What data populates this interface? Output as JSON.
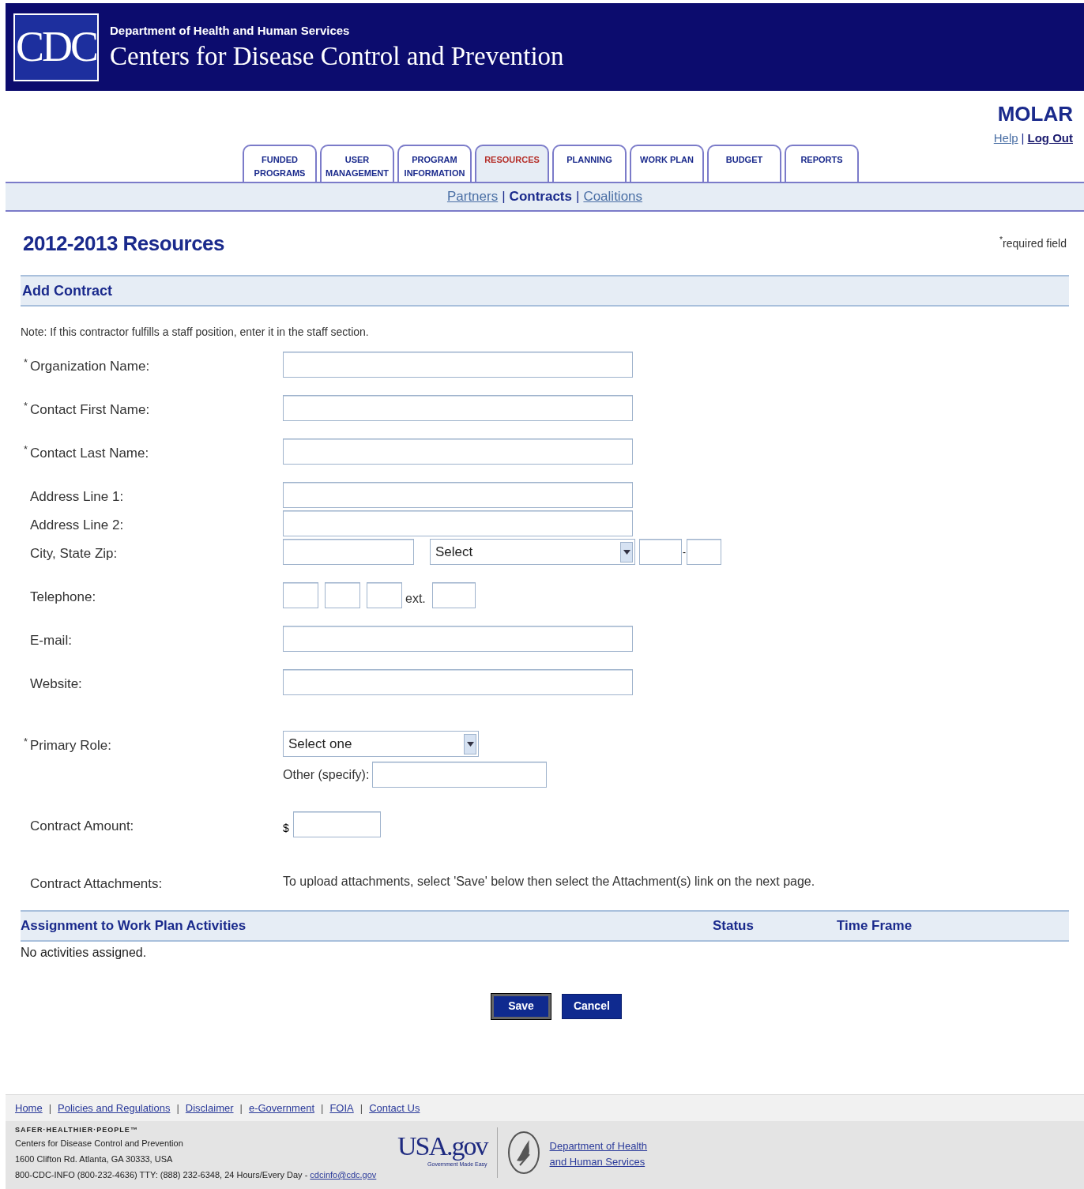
{
  "header": {
    "logo": "CDC",
    "department": "Department of Health and Human Services",
    "agency": "Centers for Disease Control and Prevention"
  },
  "app": {
    "name": "MOLAR",
    "links": [
      {
        "label": "Help",
        "current": false
      },
      {
        "label": "Log Out",
        "current": true
      }
    ]
  },
  "tabs": [
    {
      "lines": [
        "FUNDED",
        "PROGRAMS"
      ],
      "selected": false
    },
    {
      "lines": [
        "USER",
        "MANAGEMENT"
      ],
      "selected": false
    },
    {
      "lines": [
        "PROGRAM",
        "INFORMATION"
      ],
      "selected": false
    },
    {
      "lines": [
        "RESOURCES"
      ],
      "selected": true
    },
    {
      "lines": [
        "PLANNING"
      ],
      "selected": false
    },
    {
      "lines": [
        "WORK PLAN"
      ],
      "selected": false
    },
    {
      "lines": [
        "BUDGET"
      ],
      "selected": false
    },
    {
      "lines": [
        "REPORTS"
      ],
      "selected": false
    }
  ],
  "subnav": [
    {
      "label": "Partners",
      "selected": false
    },
    {
      "label": "Contracts",
      "selected": true
    },
    {
      "label": "Coalitions",
      "selected": false
    }
  ],
  "separators": {
    "app": "|",
    "subnav": "|",
    "footer": "|"
  },
  "page_title": "2012-2013 Resources",
  "required_note": "required field",
  "required_mark": "*",
  "section": "Add Contract",
  "note": "Note: If this contractor fulfills a staff position, enter it in the staff section.",
  "fields": [
    {
      "kind": "text",
      "required": true,
      "label": "Organization Name:"
    },
    {
      "kind": "text",
      "required": true,
      "label": "Contact First Name:"
    },
    {
      "kind": "text",
      "required": true,
      "label": "Contact Last Name:"
    },
    {
      "kind": "text",
      "required": false,
      "label": "Address Line 1:"
    },
    {
      "kind": "text",
      "required": false,
      "label": "Address Line 2:"
    },
    {
      "kind": "city",
      "required": false,
      "label": "City, State Zip:",
      "select": "Select",
      "zip_separator": "-"
    },
    {
      "kind": "phone",
      "required": false,
      "label": "Telephone:",
      "ext": "ext."
    },
    {
      "kind": "text",
      "required": false,
      "label": "E-mail:"
    },
    {
      "kind": "text",
      "required": false,
      "label": "Website:"
    },
    {
      "kind": "role",
      "required": true,
      "label": "Primary Role:",
      "select": "Select one",
      "other": "Other (specify):"
    },
    {
      "kind": "amount",
      "required": false,
      "label": "Contract Amount:",
      "prefix": "$"
    },
    {
      "kind": "info",
      "required": false,
      "label": "Contract Attachments:",
      "text": "To upload attachments, select 'Save' below then select the Attachment(s) link on the next page."
    }
  ],
  "assignments": {
    "columns": [
      "Assignment to Work Plan Activities",
      "Status",
      "Time Frame"
    ],
    "empty": "No activities assigned."
  },
  "buttons": [
    {
      "label": "Save",
      "focused": true
    },
    {
      "label": "Cancel",
      "focused": false
    }
  ],
  "footer": {
    "links": [
      "Home",
      "Policies and Regulations",
      "Disclaimer",
      "e-Government",
      "FOIA",
      "Contact Us"
    ],
    "tagline": "SAFER·HEALTHIER·PEOPLE™",
    "address": [
      "Centers for Disease Control and Prevention",
      "1600 Clifton Rd. Atlanta, GA 30333, USA"
    ],
    "contact": "800-CDC-INFO (800-232-4636) TTY: (888) 232-6348, 24 Hours/Every Day - ",
    "email": "cdcinfo@cdc.gov",
    "usa_logo": "USA.gov",
    "usa_tagline": "Government Made Easy",
    "hhs_link": [
      "Department of Health",
      "and Human Services"
    ]
  }
}
